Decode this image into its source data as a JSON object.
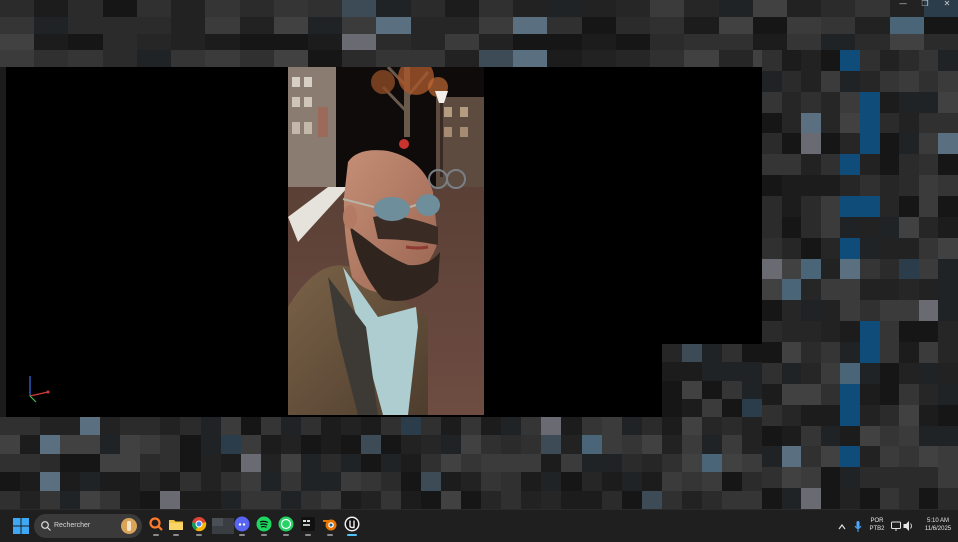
{
  "window": {
    "controls": {
      "minimize": "—",
      "maximize": "❐",
      "close": "✕"
    }
  },
  "viewport": {
    "background": "#000000",
    "scene_description_hidden": true,
    "gizmo_axes": [
      "x",
      "y",
      "z"
    ]
  },
  "taskbar": {
    "search": {
      "placeholder": "Rechercher"
    },
    "apps": [
      {
        "name": "search-app-icon"
      },
      {
        "name": "file-explorer-icon"
      },
      {
        "name": "chrome-icon"
      },
      {
        "name": "taskbar-app-thumbnail"
      },
      {
        "name": "discord-icon"
      },
      {
        "name": "spotify-icon"
      },
      {
        "name": "whatsapp-icon"
      },
      {
        "name": "terminal-app-icon"
      },
      {
        "name": "blender-icon"
      },
      {
        "name": "unreal-engine-icon"
      }
    ],
    "tray": {
      "language_line1": "POR",
      "language_line2": "PTB2",
      "time": "5:10 AM",
      "date": "11/6/2025"
    }
  },
  "colors": {
    "taskbar_bg": "#1f1f1f",
    "accent": "#4cc2ff",
    "editor_panel": "#2a2a2a"
  }
}
